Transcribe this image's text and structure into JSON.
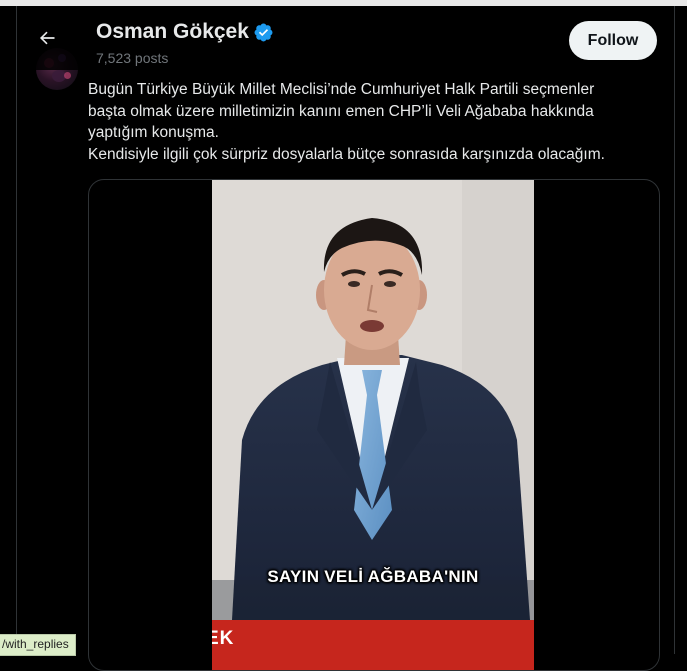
{
  "header": {
    "display_name": "Osman Gökçek",
    "post_count": "7,523 posts",
    "follow_label": "Follow"
  },
  "tweet": {
    "text": "Bugün Türkiye Büyük Millet Meclisi’nde Cumhuriyet Halk Partili seçmenler\nbaşta olmak üzere milletimizin kanını emen CHP’li Veli Ağababa hakkında\nyaptığım konuşma.\nKendisiyle ilgili çok sürpriz dosyalarla bütçe  sonrasıda karşınızda olacağım."
  },
  "media": {
    "caption": "SAYIN VELİ AĞBABA'NIN",
    "lower_third": "EK"
  },
  "status_bar": {
    "url": "/with_replies"
  },
  "colors": {
    "verified": "#1d9bf0",
    "follow_bg": "#eff3f4",
    "text_secondary": "#71767b",
    "lower_third_red": "#c6261d"
  },
  "icons": {
    "back": "arrow-left-icon",
    "verified": "verified-badge-icon"
  }
}
